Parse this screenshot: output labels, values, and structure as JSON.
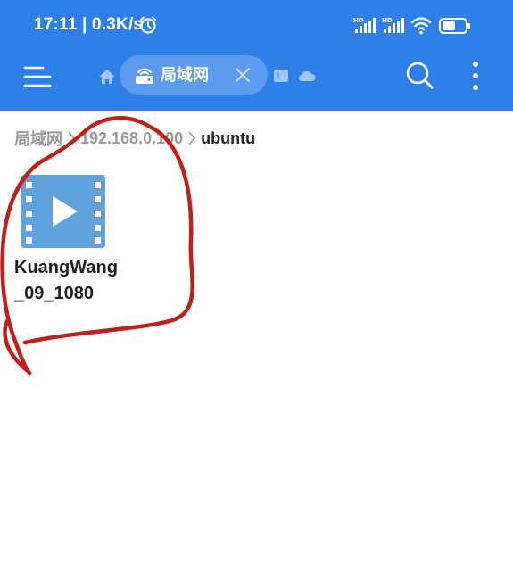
{
  "status_bar": {
    "time_speed": "17:11 | 0.3K/s",
    "icons": [
      "alarm-icon",
      "hd-signal-icon",
      "hd-signal-icon",
      "wifi-icon",
      "battery-icon"
    ]
  },
  "toolbar": {
    "accent_color": "#2f7fe8",
    "active_tab_label": "局域网",
    "icons": [
      "menu-icon",
      "home-icon",
      "network-drive-icon",
      "close-icon",
      "storage-icon",
      "cloud-icon",
      "search-icon",
      "more-vertical-icon"
    ]
  },
  "breadcrumb": {
    "items": [
      "局域网",
      "192.168.0.100",
      "ubuntu"
    ]
  },
  "files": [
    {
      "name": "KuangWang_09_1080",
      "icon": "video-file-icon"
    }
  ],
  "annotation_color": "#c0201c"
}
